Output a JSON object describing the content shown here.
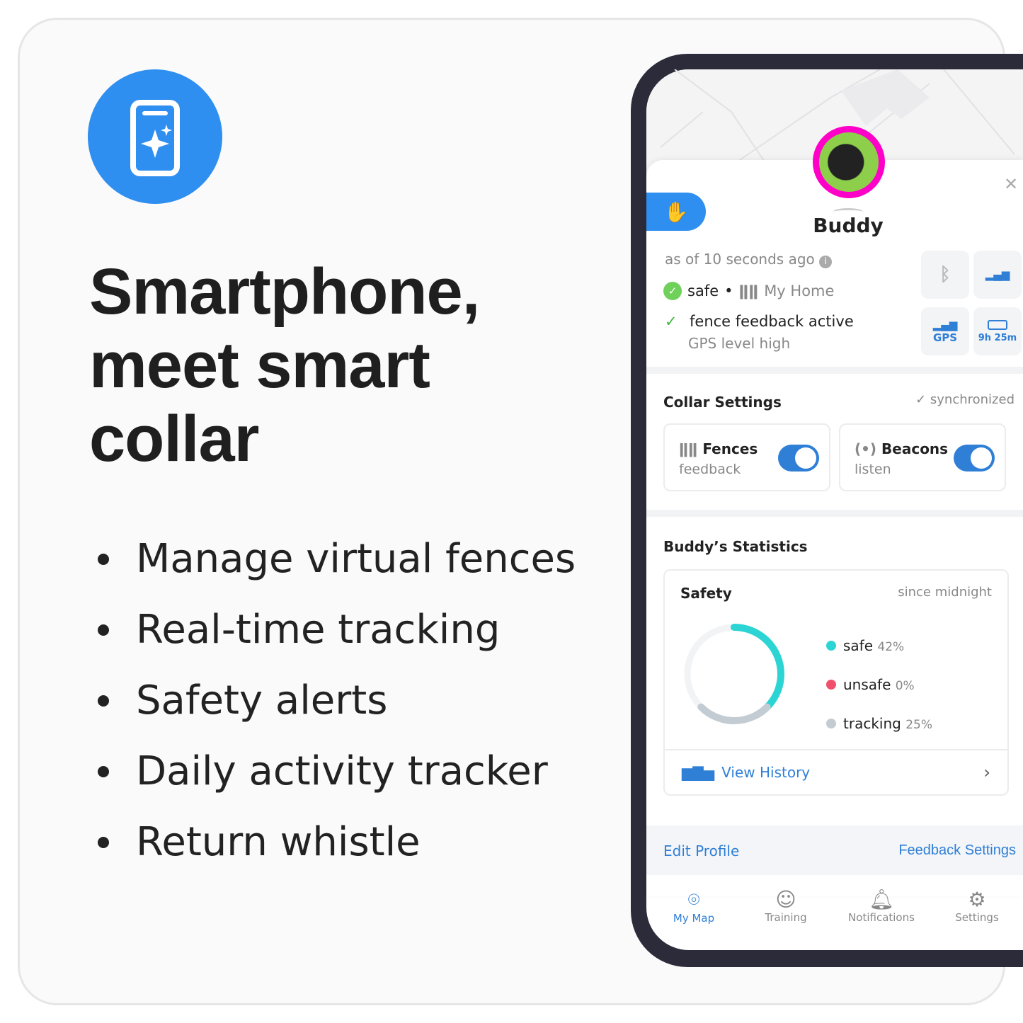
{
  "headline": {
    "line1": "Smartphone,",
    "line2": "meet smart",
    "line3": "collar"
  },
  "bullets": [
    "Manage virtual fences",
    "Real-time tracking",
    "Safety alerts",
    "Daily activity tracker",
    "Return whistle"
  ],
  "colors": {
    "accent": "#2f8ff0",
    "app_blue": "#2f7fd6",
    "avatar_ring": "#ff00c8",
    "safe": "#2dd4d4",
    "unsafe": "#f0506e",
    "tracking": "#c3ccd3"
  },
  "app": {
    "pet_name": "Buddy",
    "updated": "as of 10 seconds ago",
    "status": "safe",
    "status_sep": "•",
    "zone": "My Home",
    "feedback": "fence feedback active",
    "gps_level": "GPS level high",
    "tiles": {
      "gps": "GPS",
      "battery": "9h 25m"
    },
    "collar_settings": {
      "title": "Collar Settings",
      "sync": "synchronized",
      "fences": {
        "label": "Fences",
        "sub": "feedback",
        "on": true
      },
      "beacons": {
        "label": "Beacons",
        "sub": "listen",
        "on": true
      }
    },
    "stats": {
      "title": "Buddy’s Statistics",
      "card_title": "Safety",
      "period": "since midnight",
      "legend": [
        {
          "name": "safe",
          "value": "42%"
        },
        {
          "name": "unsafe",
          "value": "0%"
        },
        {
          "name": "tracking",
          "value": "25%"
        }
      ],
      "view_history": "View History"
    },
    "links": {
      "edit_profile": "Edit Profile",
      "feedback_settings": "Feedback Settings"
    },
    "nav": [
      {
        "label": "My Map",
        "icon": "map-pin-icon",
        "active": true
      },
      {
        "label": "Training",
        "icon": "trainer-face-icon"
      },
      {
        "label": "Notifications",
        "icon": "bell-icon"
      },
      {
        "label": "Settings",
        "icon": "gear-icon"
      }
    ]
  }
}
